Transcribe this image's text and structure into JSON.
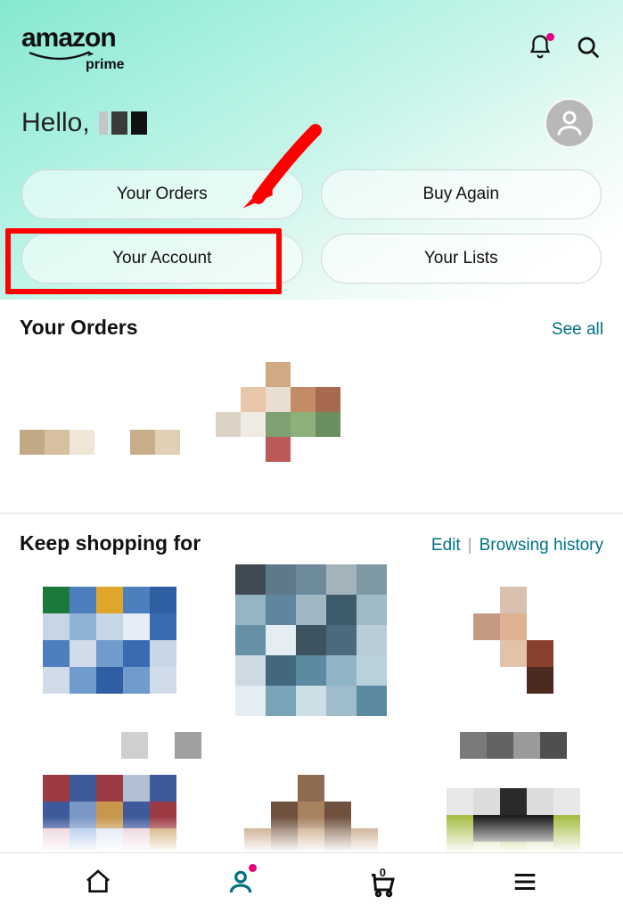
{
  "header": {
    "logo_main": "amazon",
    "logo_sub": "prime"
  },
  "greeting": {
    "prefix": "Hello,"
  },
  "pills": {
    "orders": "Your Orders",
    "buy_again": "Buy Again",
    "account": "Your Account",
    "lists": "Your Lists"
  },
  "orders_section": {
    "title": "Your Orders",
    "see_all": "See all"
  },
  "shopping_section": {
    "title": "Keep shopping for",
    "edit": "Edit",
    "history": "Browsing history"
  },
  "bottom_nav": {
    "cart_count": "0"
  },
  "colors": {
    "accent": "#007185",
    "annotation": "#ff0000",
    "notification": "#e6007e"
  }
}
